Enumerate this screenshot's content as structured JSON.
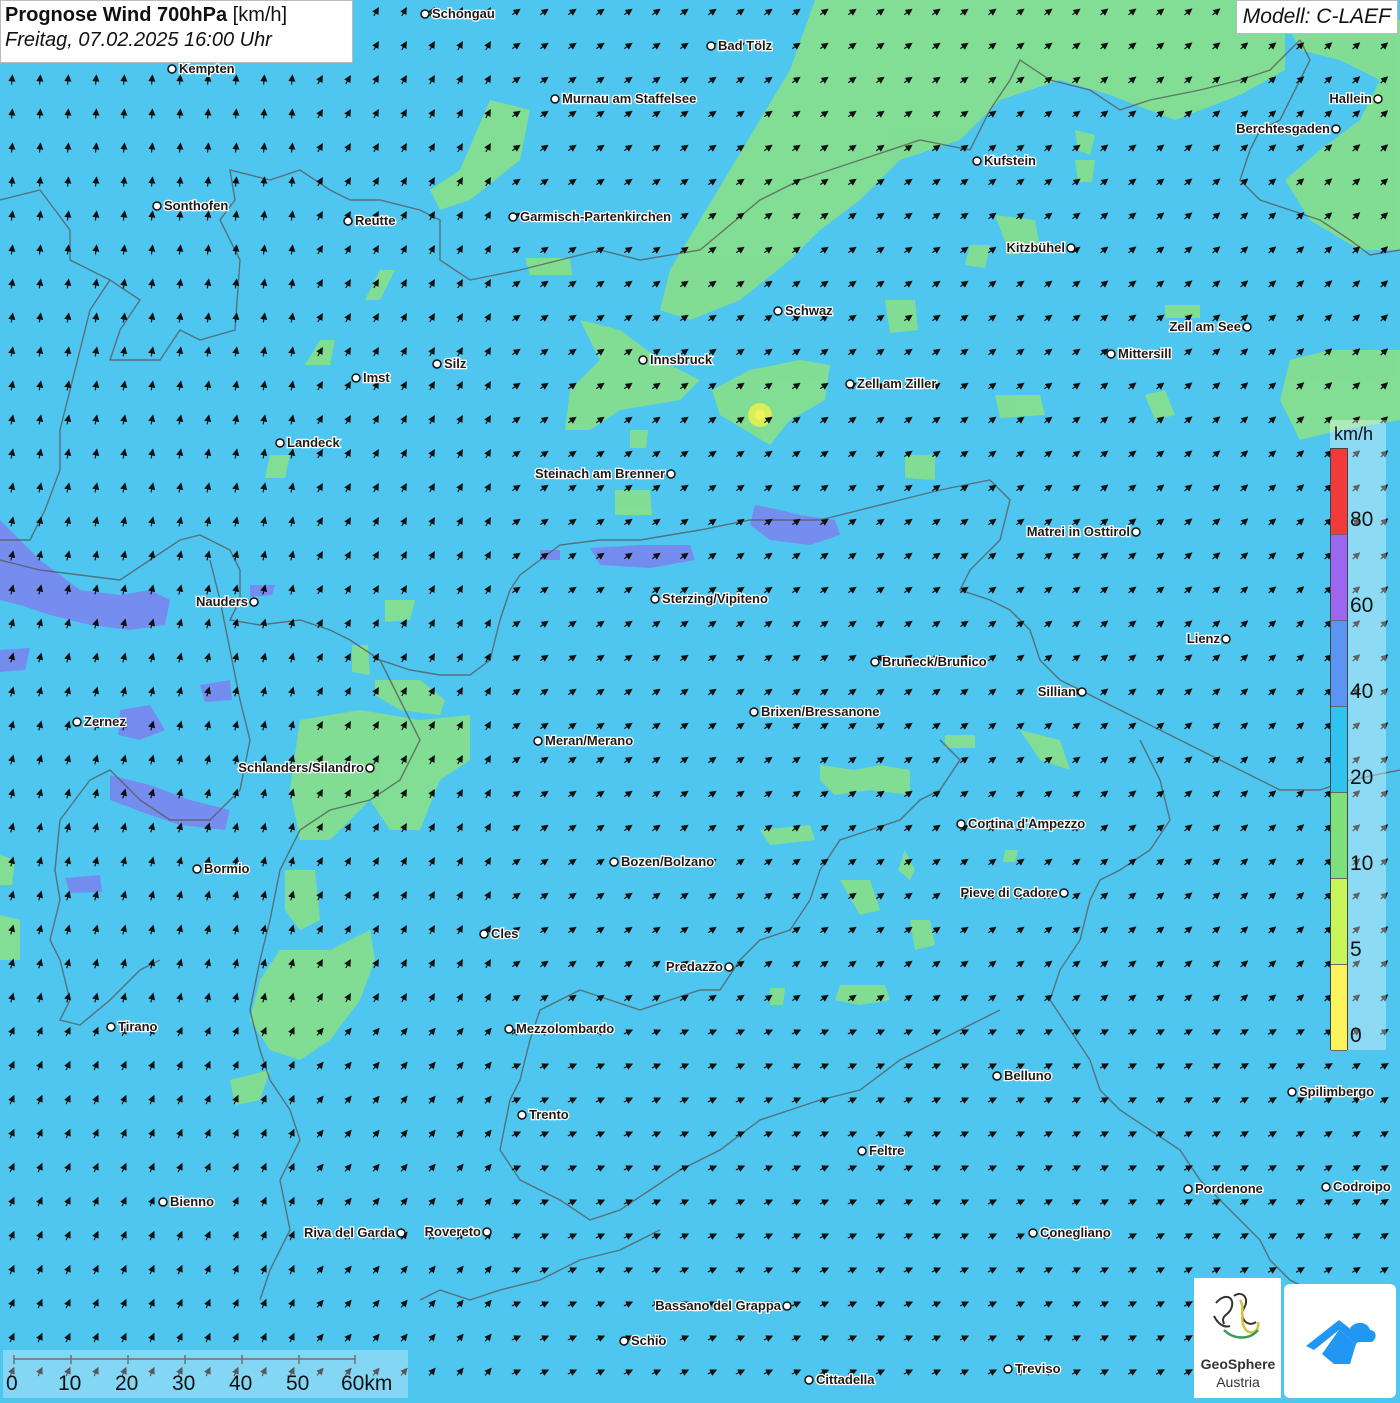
{
  "title": {
    "main": "Prognose Wind 700hPa",
    "unit": "[km/h]",
    "datetime": "Freitag, 07.02.2025 16:00 Uhr"
  },
  "model": "Modell: C-LAEF",
  "legend": {
    "unit": "km/h",
    "labels": [
      "80",
      "60",
      "40",
      "20",
      "10",
      "5",
      "0"
    ],
    "colors": [
      "#f23a3a",
      "#9b66f0",
      "#5a95f2",
      "#2fc3f0",
      "#7ee07a",
      "#c8f55a",
      "#fbf45a"
    ]
  },
  "scale": {
    "labels": [
      "0",
      "10",
      "20",
      "30",
      "40",
      "50",
      "60km"
    ]
  },
  "logos": {
    "geosphere_line1": "GeoSphere",
    "geosphere_line2": "Austria",
    "geosphere_icon": "geosphere-logo-icon",
    "app_icon": "weather-app-icon"
  },
  "colors": {
    "sea_base": "#4fc6ef",
    "green_area": "#86e08c",
    "purple_area": "#7a86f0"
  },
  "cities": [
    "Schongau",
    "Bad Tölz",
    "Kempten",
    "Murnau am Staffelsee",
    "Hallein",
    "Berchtesgaden",
    "Kufstein",
    "Sonthofen",
    "Reutte",
    "Garmisch-Partenkirchen",
    "Kitzbühel",
    "Schwaz",
    "Zell am See",
    "Mittersill",
    "Innsbruck",
    "Silz",
    "Imst",
    "Zell am Ziller",
    "Landeck",
    "Steinach am Brenner",
    "Matrei in Osttirol",
    "Nauders",
    "Sterzing/Vipiteno",
    "Lienz",
    "Bruneck/Brunico",
    "Sillian",
    "Zernez",
    "Brixen/Bressanone",
    "Meran/Merano",
    "Schlanders/Silandro",
    "Cortina d'Ampezzo",
    "Bormio",
    "Bozen/Bolzano",
    "Pieve di Cadore",
    "Cles",
    "Predazzo",
    "Tirano",
    "Mezzolombardo",
    "Belluno",
    "Spilimbergo",
    "Trento",
    "Feltre",
    "Bienno",
    "Pordenone",
    "Codroipo",
    "Riva del Garda",
    "Rovereto",
    "Conegliano",
    "Bassano del Grappa",
    "Schio",
    "Treviso",
    "Cittadella"
  ]
}
